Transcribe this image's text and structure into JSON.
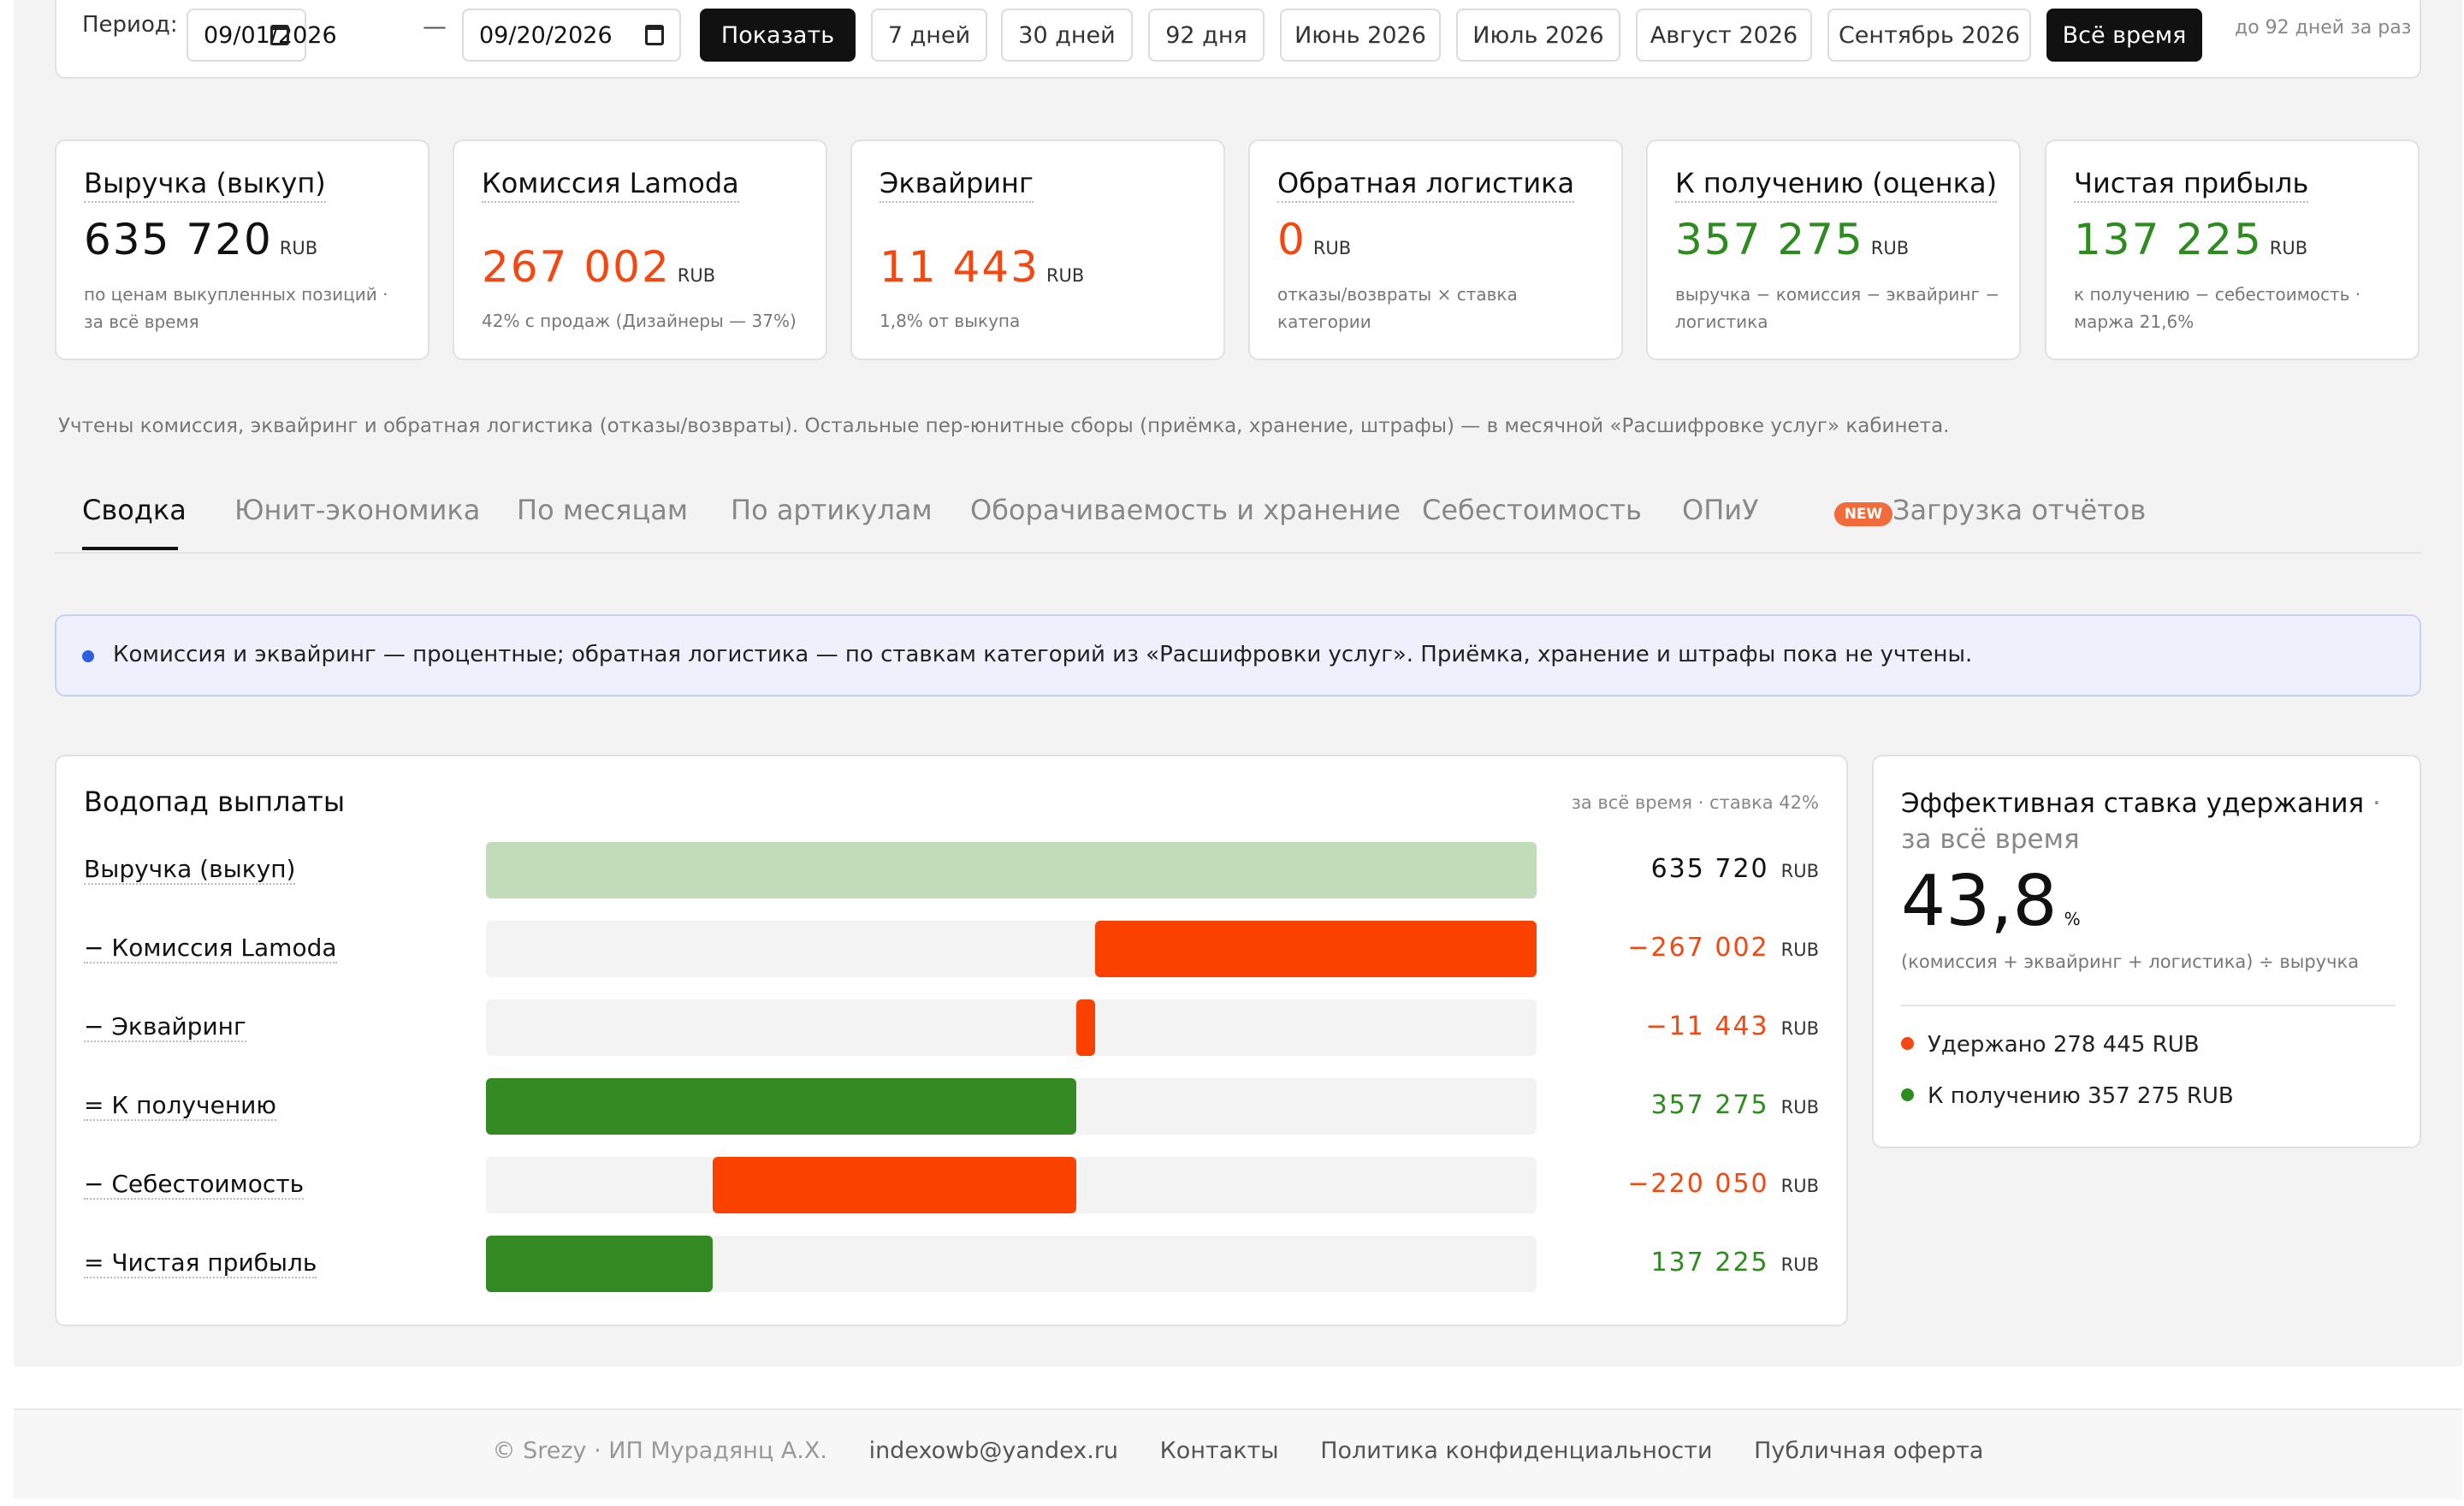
{
  "period": {
    "label": "Период:",
    "date_from": "09/01/2026",
    "date_to": "09/20/2026",
    "separator": "—",
    "show_button": "Показать",
    "presets": [
      "7 дней",
      "30 дней",
      "92 дня",
      "Июнь 2026",
      "Июль 2026",
      "Август 2026",
      "Сентябрь 2026",
      "Всё время"
    ],
    "active_preset": "Всё время",
    "note": "до 92 дней за раз"
  },
  "kpis": [
    {
      "title": "Выручка (выкуп)",
      "value": "635 720",
      "currency": "RUB",
      "desc": "по ценам выкупленных позиций · за всё время",
      "color": "#111111"
    },
    {
      "title": "Комиссия Lamoda",
      "value": "267 002",
      "currency": "RUB",
      "desc": "42% с продаж (Дизайнеры — 37%)",
      "color": "#f44711"
    },
    {
      "title": "Эквайринг",
      "value": "11 443",
      "currency": "RUB",
      "desc": "1,8% от выкупа",
      "color": "#f44711"
    },
    {
      "title": "Обратная логистика",
      "value": "0",
      "currency": "RUB",
      "desc": "отказы/возвраты × ставка категории",
      "color": "#f44711"
    },
    {
      "title": "К получению (оценка)",
      "value": "357 275",
      "currency": "RUB",
      "desc": "выручка − комиссия − эквайринг − логистика",
      "color": "#2e8b1f"
    },
    {
      "title": "Чистая прибыль",
      "value": "137 225",
      "currency": "RUB",
      "desc": "к получению − себестоимость · маржа 21,6%",
      "color": "#2e8b1f"
    }
  ],
  "disclaimer": "Учтены комиссия, эквайринг и обратная логистика (отказы/возвраты). Остальные пер-юнитные сборы (приёмка, хранение, штрафы) — в месячной «Расшифровке услуг» кабинета.",
  "tabs": [
    {
      "label": "Сводка",
      "active": true
    },
    {
      "label": "Юнит-экономика"
    },
    {
      "label": "По месяцам"
    },
    {
      "label": "По артикулам"
    },
    {
      "label": "Оборачиваемость и хранение"
    },
    {
      "label": "Себестоимость"
    },
    {
      "label": "ОПиУ",
      "badge": "NEW"
    },
    {
      "label": "Загрузка отчётов"
    }
  ],
  "info_banner": "Комиссия и эквайринг — процентные; обратная логистика — по ставкам категорий из «Расшифровки услуг». Приёмка, хранение и штрафы пока не учтены.",
  "waterfall": {
    "title": "Водопад выплаты",
    "note": "за всё время · ставка 42%",
    "currency": "RUB",
    "total": 635720,
    "rows": [
      {
        "label": "Выручка (выкуп)",
        "value_text": "635 720",
        "start": 0,
        "end": 635720,
        "color": "#c2dcb9",
        "text_color": "#111111"
      },
      {
        "label": "− Комиссия Lamoda",
        "value_text": "−267 002",
        "start": 368718,
        "end": 635720,
        "color": "#fa4100",
        "text_color": "#f44711"
      },
      {
        "label": "− Эквайринг",
        "value_text": "−11 443",
        "start": 357275,
        "end": 368718,
        "color": "#fa4100",
        "text_color": "#f44711"
      },
      {
        "label": "= К получению",
        "value_text": "357 275",
        "start": 0,
        "end": 357275,
        "color": "#338a22",
        "text_color": "#2e8b1f"
      },
      {
        "label": "− Себестоимость",
        "value_text": "−220 050",
        "start": 137225,
        "end": 357275,
        "color": "#fa4100",
        "text_color": "#f44711"
      },
      {
        "label": "= Чистая прибыль",
        "value_text": "137 225",
        "start": 0,
        "end": 137225,
        "color": "#338a22",
        "text_color": "#2e8b1f"
      }
    ]
  },
  "rate": {
    "title": "Эффективная ставка удержания",
    "subtitle": "· за всё время",
    "value": "43,8",
    "unit": "%",
    "formula": "(комиссия + эквайринг + логистика) ÷ выручка",
    "legend": [
      {
        "label": "Удержано 278 445 RUB",
        "color": "#f44711"
      },
      {
        "label": "К получению 357 275 RUB",
        "color": "#2e8b1f"
      }
    ]
  },
  "footer": {
    "copyright": "© Srezy · ИП Мурадянц А.Х.",
    "email": "indexowb@yandex.ru",
    "links": [
      "Контакты",
      "Политика конфиденциальности",
      "Публичная оферта"
    ]
  }
}
